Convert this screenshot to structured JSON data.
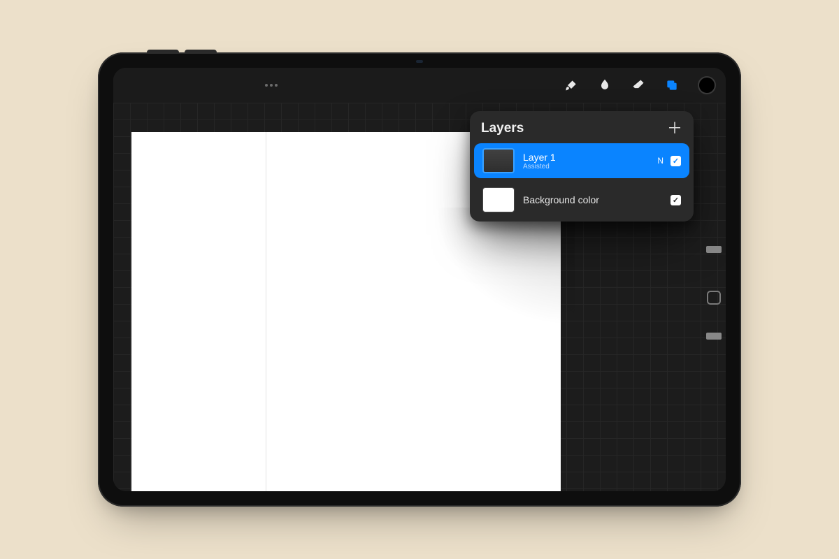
{
  "toolbar": {
    "icons": {
      "brush": "brush-icon",
      "smudge": "smudge-icon",
      "eraser": "eraser-icon",
      "layers": "layers-icon"
    }
  },
  "layers_panel": {
    "title": "Layers",
    "items": [
      {
        "name": "Layer 1",
        "subtitle": "Assisted",
        "blend": "N",
        "visible": true,
        "selected": true
      },
      {
        "name": "Background color",
        "visible": true,
        "selected": false
      }
    ]
  },
  "colors": {
    "accent": "#0a84ff",
    "panel_bg": "#2a2a2a",
    "screen_bg": "#1c1c1c",
    "page_bg": "#ece0ca"
  }
}
